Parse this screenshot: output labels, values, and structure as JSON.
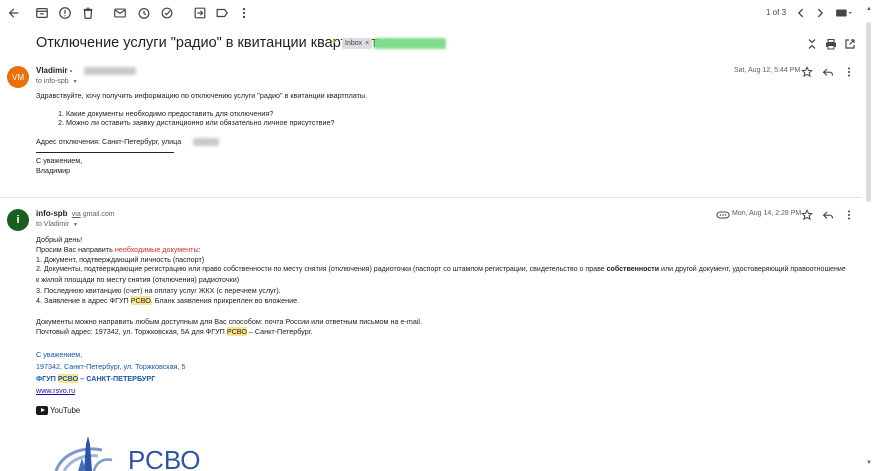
{
  "toolbar": {
    "pager": "1 of 3"
  },
  "subject": {
    "title": "Отключение услуги \"радио\" в квитанции квартплаты",
    "chip_inbox": "Inbox",
    "chip_inbox_close": "×"
  },
  "message1": {
    "avatar": "VM",
    "sender": "Vladimir -",
    "to": "to info-spb",
    "date": "Sat, Aug 12, 5:44 PM",
    "greeting": "Здравствуйте, хочу получить информацию по отключению услуги \"радио\" в квитанции квартплаты.",
    "q1": "1. Какие документы необходимо предоставить для отключения?",
    "q2": "2. Можно ли оставить заявку дистанционно или обязательно личное присутствие?",
    "address": "Адрес отключения: Санкт-Петербург, улица",
    "regards": "С уважением,",
    "name": "Владимир"
  },
  "message2": {
    "avatar": "i",
    "sender": "info-spb",
    "via": "via",
    "via_domain": "gmail.com",
    "to": "to Vladimir",
    "date": "Mon, Aug 14, 2:28 PM",
    "hello": "Добрый день!",
    "intro_a": "Просим Вас направить ",
    "intro_b": "необходимые документы",
    "intro_c": ":",
    "d1": "1. Документ, подтверждающий личность (паспорт)",
    "d2_a": "2. Документы, подтверждающие регистрацию или право собственности по месту снятия (отключения) радиоточки (паспорт со штампом регистрации, свидетельство о праве ",
    "d2_b": "собственности",
    "d2_c": " или другой документ, удостоверяющий правоотношение",
    "d2_line2": "к жилой площади по месту снятия (отключения) радиоточки)",
    "d3": "3. Последнюю квитанцию (счет) на оплату услуг ЖКХ (с перечнем услуг).",
    "d4_a": "4. Заявление в адрес ФГУП ",
    "d4_b": "РСВО",
    "d4_c": ". Бланк заявления прикреплен во вложение.",
    "send_line": "Документы можно направить любым доступным для Вас способом: почта России или ответным письмом на e-mail.",
    "post_a": "Почтовый адрес: 197342, ул. Торжковская, 5А для ФГУП ",
    "post_b": "РСВО",
    "post_c": " – Санкт-Петербург.",
    "sig_regards": "С уважением,",
    "sig_address": "197342, Санкт-Петербург, ул. Торжковская, 5",
    "sig_org_a": "ФГУП ",
    "sig_org_b": "РСВО",
    "sig_org_c": " – САНКТ-ПЕТЕРБУРГ",
    "sig_site": "www.rsvo.ru",
    "youtube": "YouTube",
    "logo_text": "РСВО"
  },
  "colors": {
    "avatar_vm": "#e8710a",
    "avatar_i": "#1b5e20",
    "highlight": "#fce48a",
    "link": "#1a0dab",
    "signature_blue": "#1a56a5",
    "accent_red": "#d93025"
  },
  "icons": [
    "back-arrow-icon",
    "archive-icon",
    "report-spam-icon",
    "delete-icon",
    "mark-unread-icon",
    "snooze-icon",
    "add-task-icon",
    "move-to-icon",
    "label-icon",
    "more-vert-icon",
    "chevron-left-icon",
    "chevron-right-icon",
    "keyboard-icon",
    "collapse-icon",
    "print-icon",
    "open-new-window-icon",
    "star-icon",
    "reply-icon",
    "more-vert-icon",
    "hidden-text-icon"
  ]
}
